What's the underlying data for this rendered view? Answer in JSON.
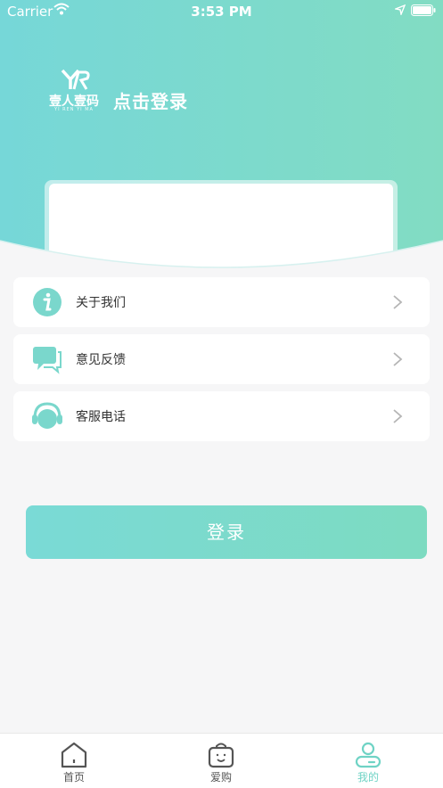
{
  "status_bar": {
    "carrier": "Carrier",
    "time": "3:53 PM"
  },
  "header": {
    "logo_main": "壹人壹码",
    "logo_sub": "YI REN YI MA",
    "login_prompt": "点击登录"
  },
  "menu": [
    {
      "label": "关于我们",
      "icon": "info-icon"
    },
    {
      "label": "意见反馈",
      "icon": "chat-bubble-icon"
    },
    {
      "label": "客服电话",
      "icon": "headset-icon"
    }
  ],
  "login_button": "登录",
  "tabbar": [
    {
      "label": "首页",
      "icon": "home-icon",
      "active": false
    },
    {
      "label": "爱购",
      "icon": "shopping-bag-icon",
      "active": false
    },
    {
      "label": "我的",
      "icon": "user-icon",
      "active": true
    }
  ],
  "colors": {
    "accent": "#6fd3c5",
    "gradient_start": "#74d6d6",
    "gradient_end": "#84dcc4"
  }
}
